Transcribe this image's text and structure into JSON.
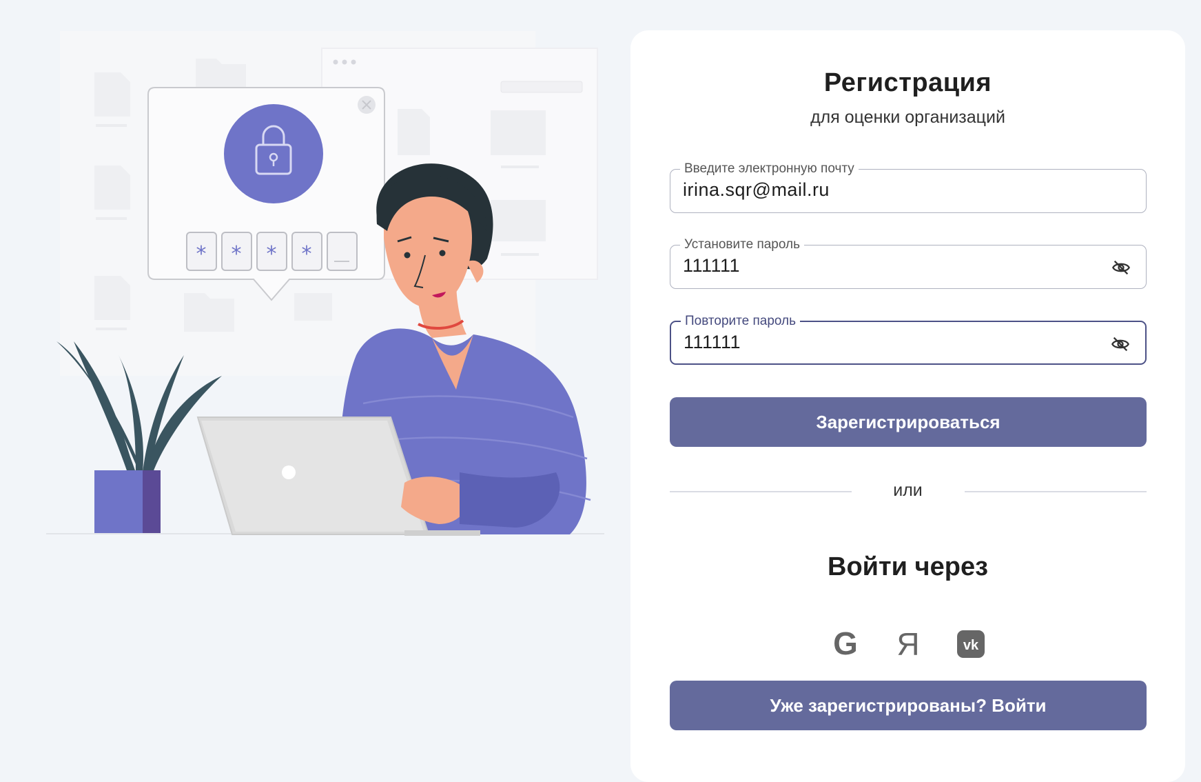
{
  "registration": {
    "title": "Регистрация",
    "subtitle": "для оценки организаций",
    "email": {
      "label": "Введите электронную почту",
      "value": "irina.sqr@mail.ru"
    },
    "password": {
      "label": "Установите пароль",
      "value": "111111"
    },
    "repeat_password": {
      "label": "Повторите пароль",
      "value": "111111"
    },
    "register_button": "Зарегистрироваться",
    "or": "или",
    "login_via": "Войти через",
    "social": {
      "google": "G",
      "yandex": "Я",
      "vk": "vk"
    },
    "login_button": "Уже зарегистрированы? Войти"
  },
  "colors": {
    "accent": "#646a9c",
    "illustration_purple": "#6f74c8",
    "background": "#f2f5f9"
  }
}
